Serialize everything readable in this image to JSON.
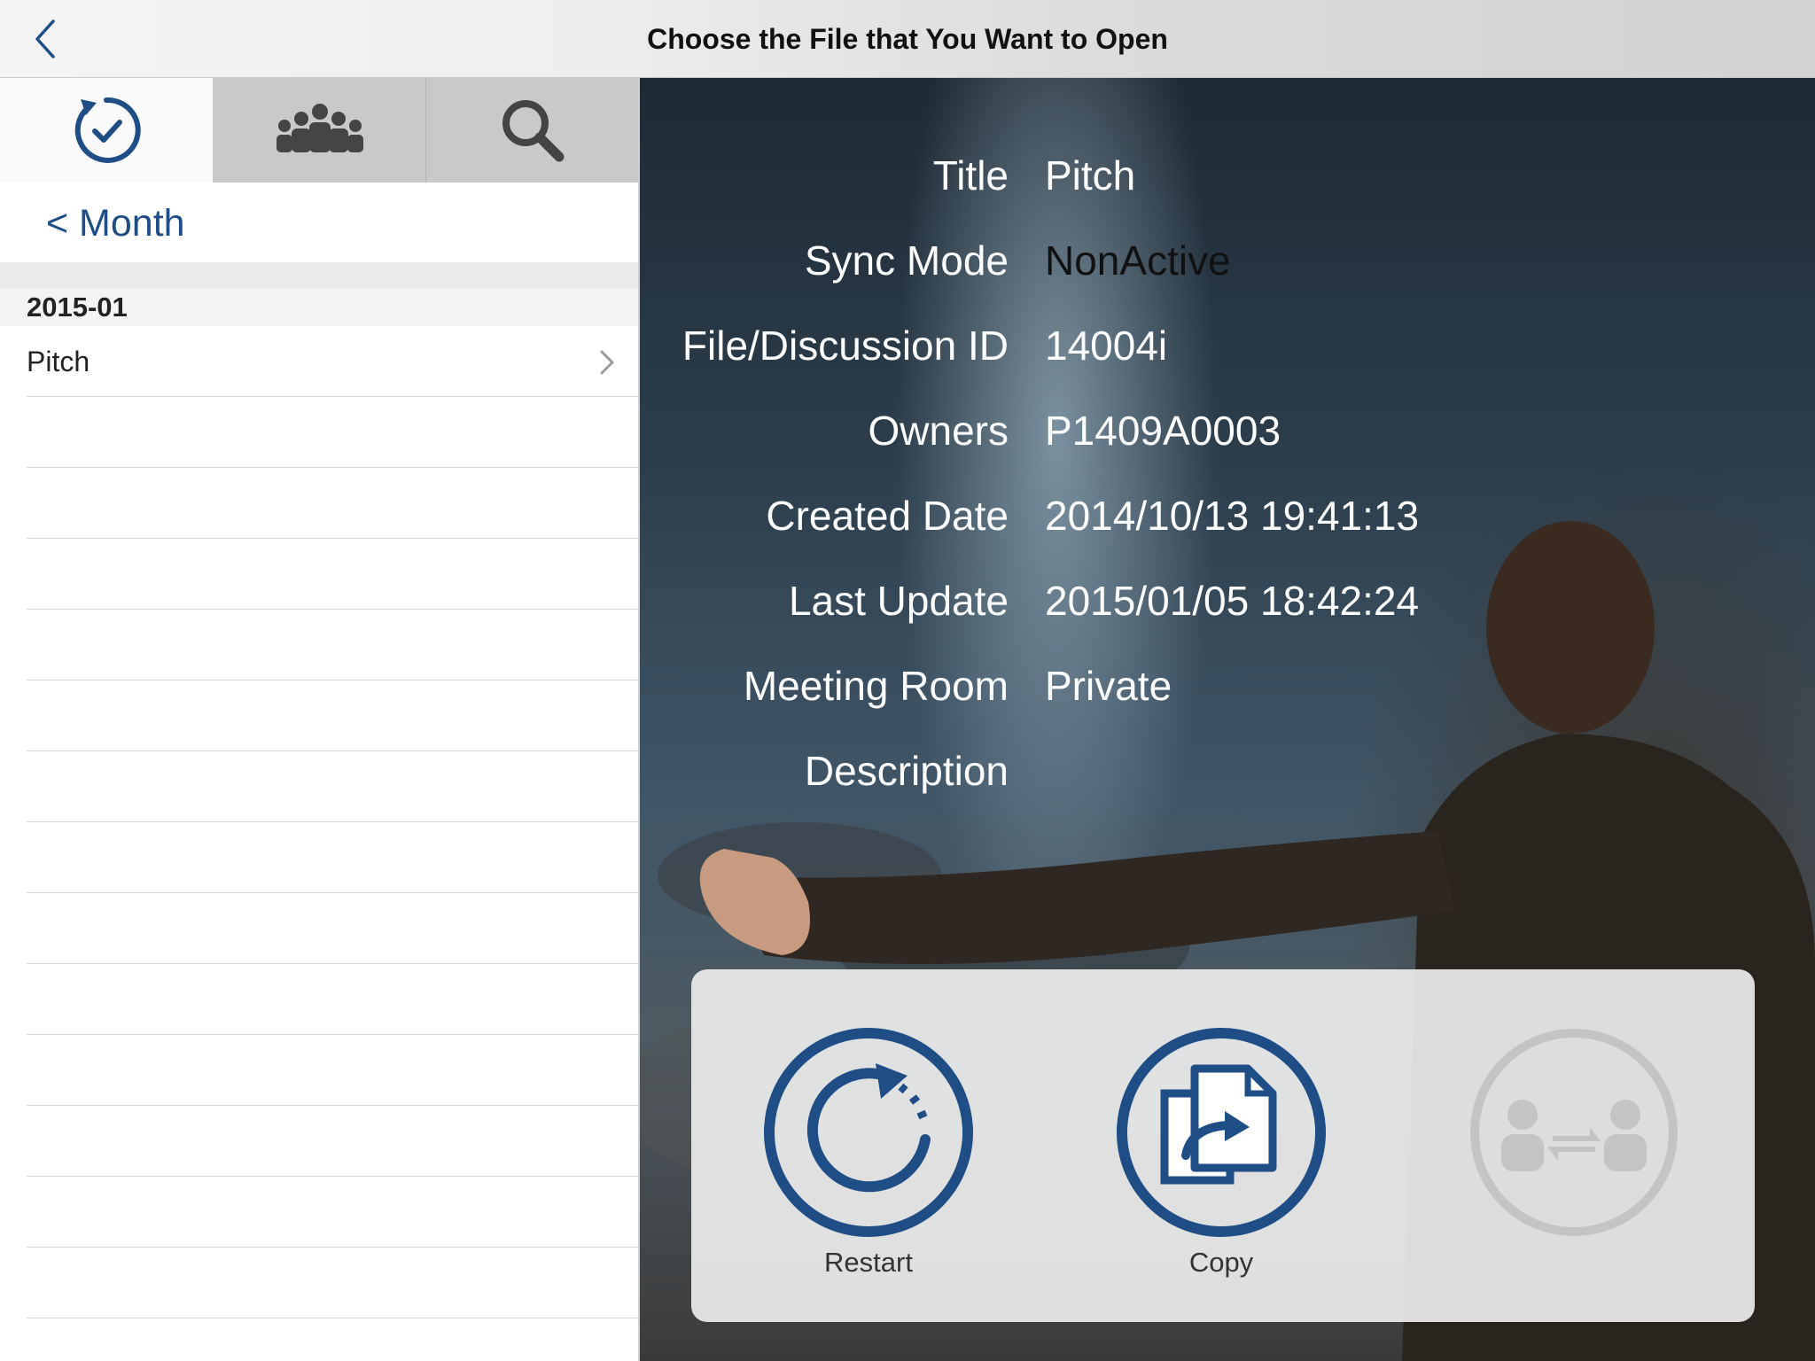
{
  "navbar": {
    "title": "Choose the File that You Want to Open",
    "back_icon": "chevron-left-icon"
  },
  "sidebar": {
    "tabs": [
      {
        "icon": "recent-clock-icon",
        "selected": true
      },
      {
        "icon": "group-people-icon",
        "selected": false
      },
      {
        "icon": "search-icon",
        "selected": false
      }
    ],
    "back_link": "< Month",
    "section_header": "2015-01",
    "items": [
      {
        "label": "Pitch"
      }
    ]
  },
  "details": {
    "rows": [
      {
        "label": "Title",
        "value": "Pitch"
      },
      {
        "label": "Sync Mode",
        "value": "NonActive"
      },
      {
        "label": "File/Discussion ID",
        "value": "14004i"
      },
      {
        "label": "Owners",
        "value": "P1409A0003"
      },
      {
        "label": "Created Date",
        "value": "2014/10/13 19:41:13"
      },
      {
        "label": "Last Update",
        "value": "2015/01/05 18:42:24"
      },
      {
        "label": "Meeting Room",
        "value": "Private"
      },
      {
        "label": "Description",
        "value": ""
      }
    ]
  },
  "actions": {
    "restart_label": "Restart",
    "copy_label": "Copy",
    "transfer_label": ""
  },
  "colors": {
    "accent": "#1f4e86",
    "disabled": "#c4c4c4"
  }
}
